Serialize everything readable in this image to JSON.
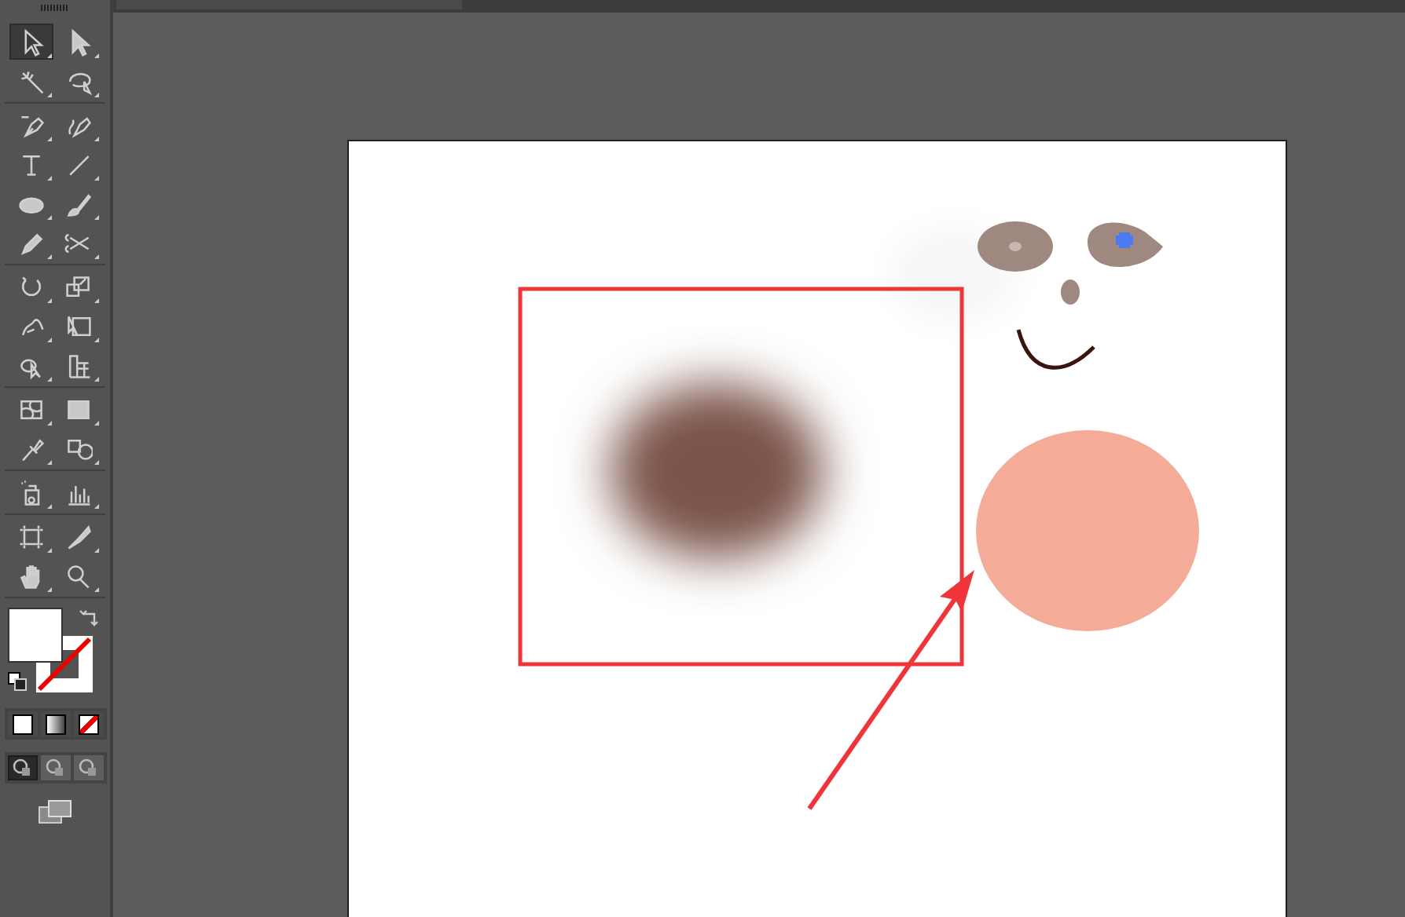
{
  "toolbar": {
    "tool_groups": [
      {
        "tools": [
          {
            "kind": "select",
            "selected": true
          },
          {
            "kind": "direct-select",
            "selected": false
          },
          {
            "kind": "magic-wand",
            "selected": false
          },
          {
            "kind": "lasso",
            "selected": false
          }
        ]
      },
      {
        "tools": [
          {
            "kind": "pen",
            "selected": false
          },
          {
            "kind": "curvature",
            "selected": false
          },
          {
            "kind": "type",
            "selected": false
          },
          {
            "kind": "line",
            "selected": false
          },
          {
            "kind": "ellipse",
            "selected": false
          },
          {
            "kind": "brush",
            "selected": false
          },
          {
            "kind": "pencil",
            "selected": false
          },
          {
            "kind": "scissors",
            "selected": false
          }
        ]
      },
      {
        "tools": [
          {
            "kind": "rotate",
            "selected": false
          },
          {
            "kind": "scale",
            "selected": false
          },
          {
            "kind": "puppet",
            "selected": false
          },
          {
            "kind": "free-transform",
            "selected": false
          },
          {
            "kind": "shape-builder",
            "selected": false
          },
          {
            "kind": "perspective",
            "selected": false
          }
        ]
      },
      {
        "tools": [
          {
            "kind": "mesh",
            "selected": false
          },
          {
            "kind": "gradient",
            "selected": false
          },
          {
            "kind": "eyedropper",
            "selected": false
          },
          {
            "kind": "blend",
            "selected": false
          }
        ]
      },
      {
        "tools": [
          {
            "kind": "sprayer",
            "selected": false
          },
          {
            "kind": "graph",
            "selected": false
          }
        ]
      },
      {
        "tools": [
          {
            "kind": "artboard",
            "selected": false
          },
          {
            "kind": "slice",
            "selected": false
          },
          {
            "kind": "hand",
            "selected": false
          },
          {
            "kind": "zoom",
            "selected": false
          }
        ]
      }
    ],
    "draw_modes": [
      {
        "selected": true
      },
      {
        "selected": false
      },
      {
        "selected": false
      }
    ]
  }
}
